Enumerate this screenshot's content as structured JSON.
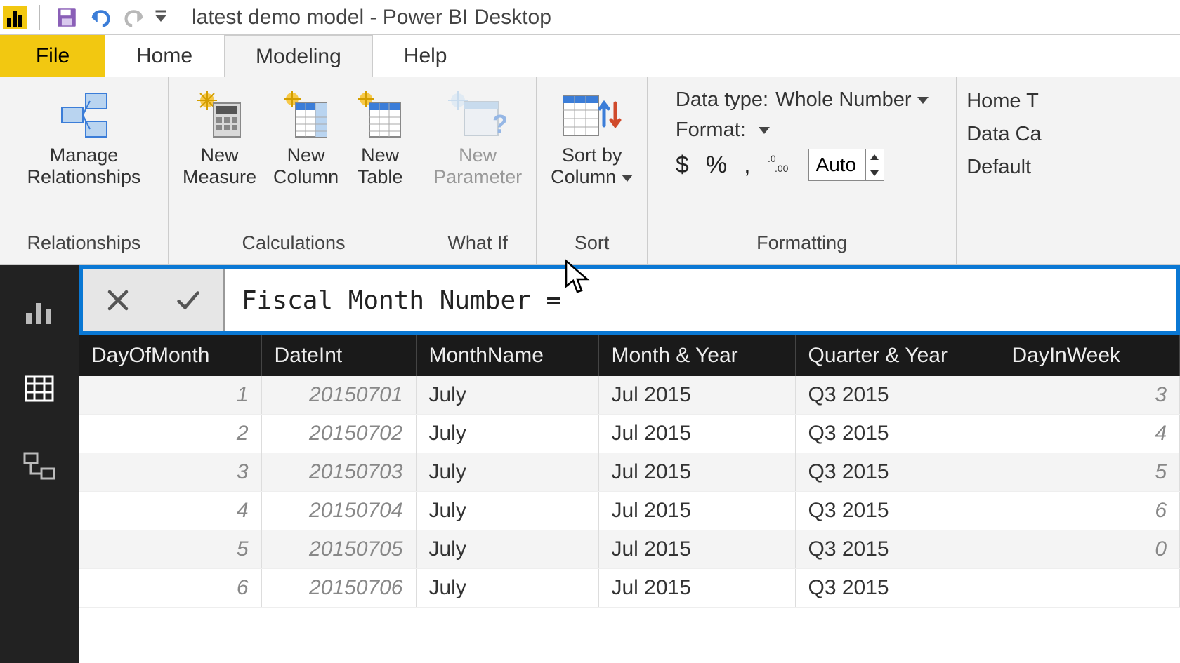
{
  "title": "latest demo model - Power BI Desktop",
  "tabs": {
    "file": "File",
    "home": "Home",
    "modeling": "Modeling",
    "help": "Help"
  },
  "ribbon": {
    "relationships": {
      "manage": "Manage\nRelationships",
      "group": "Relationships"
    },
    "calculations": {
      "newMeasure": "New\nMeasure",
      "newColumn": "New\nColumn",
      "newTable": "New\nTable",
      "group": "Calculations"
    },
    "whatIf": {
      "newParameter": "New\nParameter",
      "group": "What If"
    },
    "sort": {
      "sortBy": "Sort by\nColumn",
      "group": "Sort"
    },
    "formatting": {
      "dataTypeLabel": "Data type:",
      "dataTypeValue": "Whole Number",
      "formatLabel": "Format:",
      "decimalsValue": "Auto",
      "group": "Formatting"
    },
    "properties": {
      "homeTable": "Home T",
      "dataCategory": "Data Ca",
      "defaultSummarization": "Default"
    }
  },
  "formula": "Fiscal Month Number =",
  "table": {
    "columns": [
      "DayOfMonth",
      "DateInt",
      "MonthName",
      "Month & Year",
      "Quarter & Year",
      "DayInWeek"
    ],
    "rows": [
      {
        "day": "1",
        "dateint": "20150701",
        "month": "July",
        "my": "Jul 2015",
        "qy": "Q3 2015",
        "diw": "3"
      },
      {
        "day": "2",
        "dateint": "20150702",
        "month": "July",
        "my": "Jul 2015",
        "qy": "Q3 2015",
        "diw": "4"
      },
      {
        "day": "3",
        "dateint": "20150703",
        "month": "July",
        "my": "Jul 2015",
        "qy": "Q3 2015",
        "diw": "5"
      },
      {
        "day": "4",
        "dateint": "20150704",
        "month": "July",
        "my": "Jul 2015",
        "qy": "Q3 2015",
        "diw": "6"
      },
      {
        "day": "5",
        "dateint": "20150705",
        "month": "July",
        "my": "Jul 2015",
        "qy": "Q3 2015",
        "diw": "0"
      },
      {
        "day": "6",
        "dateint": "20150706",
        "month": "July",
        "my": "Jul 2015",
        "qy": "Q3 2015",
        "diw": ""
      }
    ]
  }
}
